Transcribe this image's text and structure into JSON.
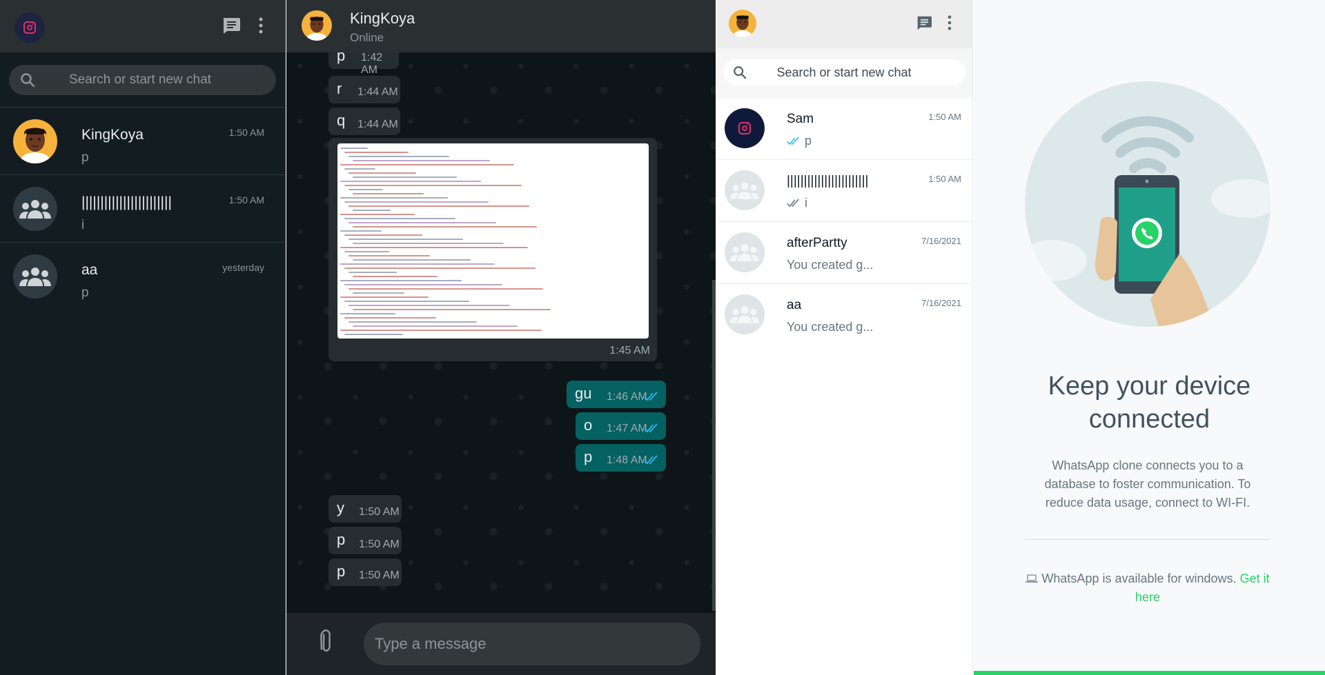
{
  "dark_sidebar": {
    "search_placeholder": "Search or start new chat",
    "chats": [
      {
        "name": "KingKoya",
        "time": "1:50 AM",
        "preview": "p"
      },
      {
        "name": "||||||||||||||||||||||||",
        "time": "1:50 AM",
        "preview": "i"
      },
      {
        "name": "aa",
        "time": "yesterday",
        "preview": "p"
      }
    ]
  },
  "chat": {
    "contact_name": "KingKoya",
    "status": "Online",
    "messages": [
      {
        "text": "p",
        "time": "1:42 AM",
        "dir": "in"
      },
      {
        "text": "r",
        "time": "1:44 AM",
        "dir": "in"
      },
      {
        "text": "q",
        "time": "1:44 AM",
        "dir": "in"
      },
      {
        "text": "",
        "time": "1:45 AM",
        "dir": "in",
        "type": "image"
      },
      {
        "text": "gu",
        "time": "1:46 AM",
        "dir": "out"
      },
      {
        "text": "o",
        "time": "1:47 AM",
        "dir": "out"
      },
      {
        "text": "p",
        "time": "1:48 AM",
        "dir": "out"
      },
      {
        "text": "y",
        "time": "1:50 AM",
        "dir": "in"
      },
      {
        "text": "p",
        "time": "1:50 AM",
        "dir": "in"
      },
      {
        "text": "p",
        "time": "1:50 AM",
        "dir": "in"
      }
    ],
    "input_placeholder": "Type a message"
  },
  "light_sidebar": {
    "search_placeholder": "Search or start new chat",
    "chats": [
      {
        "name": "Sam",
        "time": "1:50 AM",
        "preview": "p",
        "tick_color": "#34b7f1"
      },
      {
        "name": "||||||||||||||||||||||||",
        "time": "1:50 AM",
        "preview": "i",
        "tick_color": "#667781"
      },
      {
        "name": "afterPartty",
        "time": "7/16/2021",
        "preview": "You created g..."
      },
      {
        "name": "aa",
        "time": "7/16/2021",
        "preview": "You created g..."
      }
    ]
  },
  "intro": {
    "title_line1": "Keep your device",
    "title_line2": "connected",
    "text": "WhatsApp clone connects you to a database to foster communication. To reduce data usage, connect to WI-FI.",
    "windows_text": "WhatsApp is available for windows.",
    "get_link": "Get it here"
  },
  "colors": {
    "accent": "#25d366",
    "outgoing_bubble": "#056162",
    "read_ticks": "#34b7f1"
  }
}
